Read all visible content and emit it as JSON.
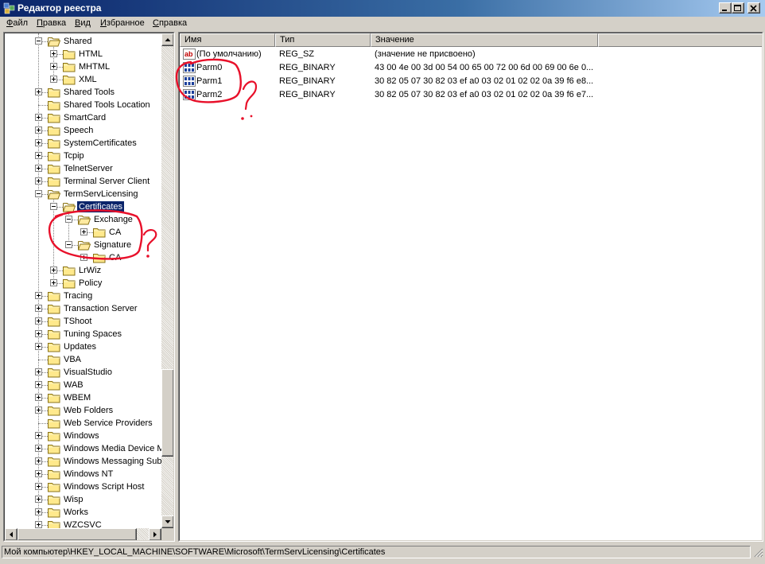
{
  "window": {
    "title": "Редактор реестра"
  },
  "menu": [
    {
      "label": "Файл",
      "u": "Ф",
      "rest": "айл"
    },
    {
      "label": "Правка",
      "u": "П",
      "rest": "равка"
    },
    {
      "label": "Вид",
      "u": "В",
      "rest": "ид"
    },
    {
      "label": "Избранное",
      "u": "И",
      "rest": "збранное"
    },
    {
      "label": "Справка",
      "u": "С",
      "rest": "правка"
    }
  ],
  "tree": [
    {
      "label": "Shared",
      "expander": "minus",
      "open": true
    },
    {
      "label": "HTML",
      "expander": "plus"
    },
    {
      "label": "MHTML",
      "expander": "plus"
    },
    {
      "label": "XML",
      "expander": "plus"
    },
    {
      "label": "Shared Tools",
      "expander": "plus"
    },
    {
      "label": "Shared Tools Location",
      "expander": "none"
    },
    {
      "label": "SmartCard",
      "expander": "plus"
    },
    {
      "label": "Speech",
      "expander": "plus"
    },
    {
      "label": "SystemCertificates",
      "expander": "plus"
    },
    {
      "label": "Tcpip",
      "expander": "plus"
    },
    {
      "label": "TelnetServer",
      "expander": "plus"
    },
    {
      "label": "Terminal Server Client",
      "expander": "plus"
    },
    {
      "label": "TermServLicensing",
      "expander": "minus",
      "open": true
    },
    {
      "label": "Certificates",
      "expander": "minus",
      "open": true,
      "selected": true
    },
    {
      "label": "Exchange",
      "expander": "minus",
      "open": true
    },
    {
      "label": "CA",
      "expander": "plus"
    },
    {
      "label": "Signature",
      "expander": "minus",
      "open": true
    },
    {
      "label": "CA",
      "expander": "plus"
    },
    {
      "label": "LrWiz",
      "expander": "plus"
    },
    {
      "label": "Policy",
      "expander": "plus"
    },
    {
      "label": "Tracing",
      "expander": "plus"
    },
    {
      "label": "Transaction Server",
      "expander": "plus"
    },
    {
      "label": "TShoot",
      "expander": "plus"
    },
    {
      "label": "Tuning Spaces",
      "expander": "plus"
    },
    {
      "label": "Updates",
      "expander": "plus"
    },
    {
      "label": "VBA",
      "expander": "none"
    },
    {
      "label": "VisualStudio",
      "expander": "plus"
    },
    {
      "label": "WAB",
      "expander": "plus"
    },
    {
      "label": "WBEM",
      "expander": "plus"
    },
    {
      "label": "Web Folders",
      "expander": "plus"
    },
    {
      "label": "Web Service Providers",
      "expander": "none"
    },
    {
      "label": "Windows",
      "expander": "plus"
    },
    {
      "label": "Windows Media Device M",
      "expander": "plus"
    },
    {
      "label": "Windows Messaging Subs",
      "expander": "plus"
    },
    {
      "label": "Windows NT",
      "expander": "plus"
    },
    {
      "label": "Windows Script Host",
      "expander": "plus"
    },
    {
      "label": "Wisp",
      "expander": "plus"
    },
    {
      "label": "Works",
      "expander": "plus"
    },
    {
      "label": "WZCSVC",
      "expander": "plus"
    }
  ],
  "list": {
    "columns": [
      "Имя",
      "Тип",
      "Значение"
    ],
    "rows": [
      {
        "icon": "string-value-icon",
        "name": "(По умолчанию)",
        "type": "REG_SZ",
        "value": "(значение не присвоено)"
      },
      {
        "icon": "binary-value-icon",
        "name": "Parm0",
        "type": "REG_BINARY",
        "value": "43 00 4e 00 3d 00 54 00 65 00 72 00 6d 00 69 00 6e 0..."
      },
      {
        "icon": "binary-value-icon",
        "name": "Parm1",
        "type": "REG_BINARY",
        "value": "30 82 05 07 30 82 03 ef a0 03 02 01 02 02 0a 39 f6 e8..."
      },
      {
        "icon": "binary-value-icon",
        "name": "Parm2",
        "type": "REG_BINARY",
        "value": "30 82 05 07 30 82 03 ef a0 03 02 01 02 02 0a 39 f6 e7..."
      }
    ]
  },
  "status": {
    "path": "Мой компьютер\\HKEY_LOCAL_MACHINE\\SOFTWARE\\Microsoft\\TermServLicensing\\Certificates"
  },
  "annotation": {
    "color": "#e8102a",
    "mark": "?"
  }
}
